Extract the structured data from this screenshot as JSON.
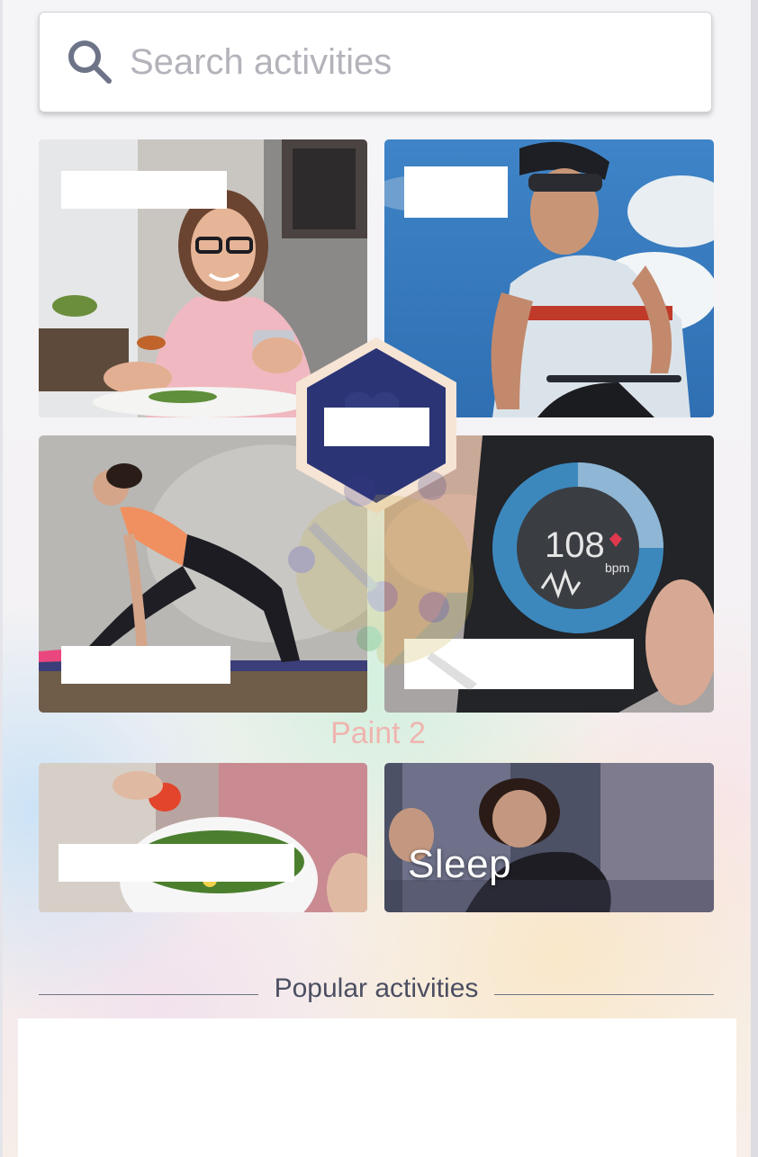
{
  "search": {
    "placeholder": "Search activities",
    "icon": "magnifier-icon",
    "icon_color": "#6e7488"
  },
  "tiles": [
    {
      "id": "food-logging",
      "image": "woman eating salad and checking phone"
    },
    {
      "id": "cycling",
      "image": "cyclist with helmet"
    },
    {
      "id": "stretching",
      "image": "woman stretching on yoga mat"
    },
    {
      "id": "heart-rate",
      "image": "phone showing heart rate app",
      "screen_value": "108",
      "screen_unit": "bpm"
    },
    {
      "id": "nutrition",
      "image": "salad bowl with tomatoes"
    },
    {
      "id": "sleep",
      "image": "woman waking up in bed",
      "label": "Sleep"
    }
  ],
  "center_badge": {
    "icon": "hexagon-badge-icon",
    "color": "#2b3474"
  },
  "watermark": {
    "caption": "Paint 2"
  },
  "popular": {
    "title": "Popular activities"
  }
}
